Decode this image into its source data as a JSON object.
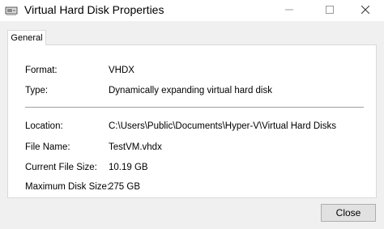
{
  "window": {
    "title": "Virtual Hard Disk Properties"
  },
  "tabs": [
    {
      "label": "General"
    }
  ],
  "properties": {
    "format_label": "Format:",
    "format_value": "VHDX",
    "type_label": "Type:",
    "type_value": "Dynamically expanding virtual hard disk",
    "location_label": "Location:",
    "location_value": "C:\\Users\\Public\\Documents\\Hyper-V\\Virtual Hard Disks",
    "filename_label": "File Name:",
    "filename_value": "TestVM.vhdx",
    "current_size_label": "Current File Size:",
    "current_size_value": "10.19 GB",
    "max_size_label": "Maximum Disk Size:",
    "max_size_value": "275 GB"
  },
  "buttons": {
    "close_label": "Close"
  },
  "icons": {
    "app": "virtual-disk-icon",
    "minimize": "minimize-icon",
    "maximize": "maximize-icon",
    "close": "close-icon"
  }
}
